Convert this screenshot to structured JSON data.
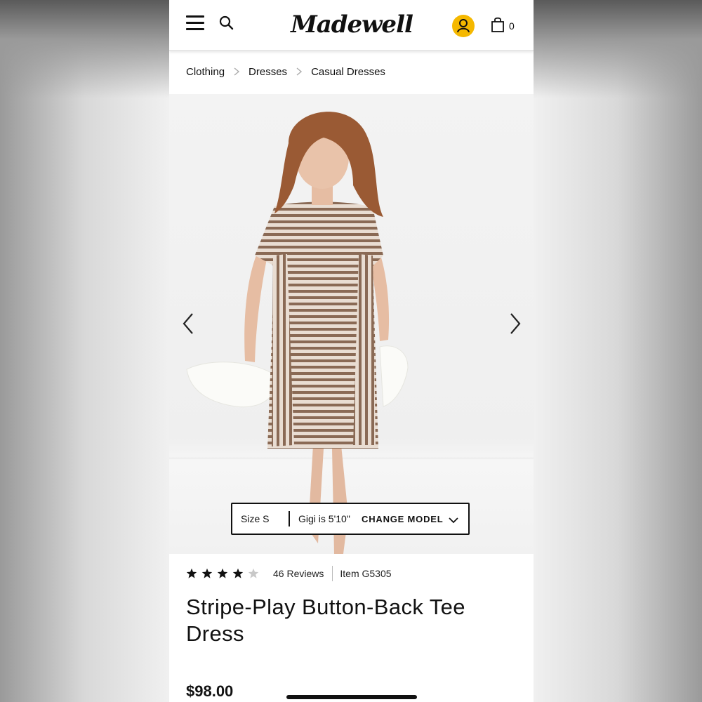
{
  "header": {
    "logo_text": "Madewell",
    "cart_count": "0",
    "accent_color": "#f5b800"
  },
  "breadcrumb": {
    "items": [
      "Clothing",
      "Dresses",
      "Casual Dresses"
    ]
  },
  "model_info": {
    "size": "Size S",
    "height": "Gigi is 5'10\"",
    "change_label": "CHANGE MODEL"
  },
  "product": {
    "rating": 4,
    "rating_max": 5,
    "reviews": "46 Reviews",
    "item_number": "Item G5305",
    "title": "Stripe-Play Button-Back Tee Dress",
    "price": "$98.00"
  }
}
